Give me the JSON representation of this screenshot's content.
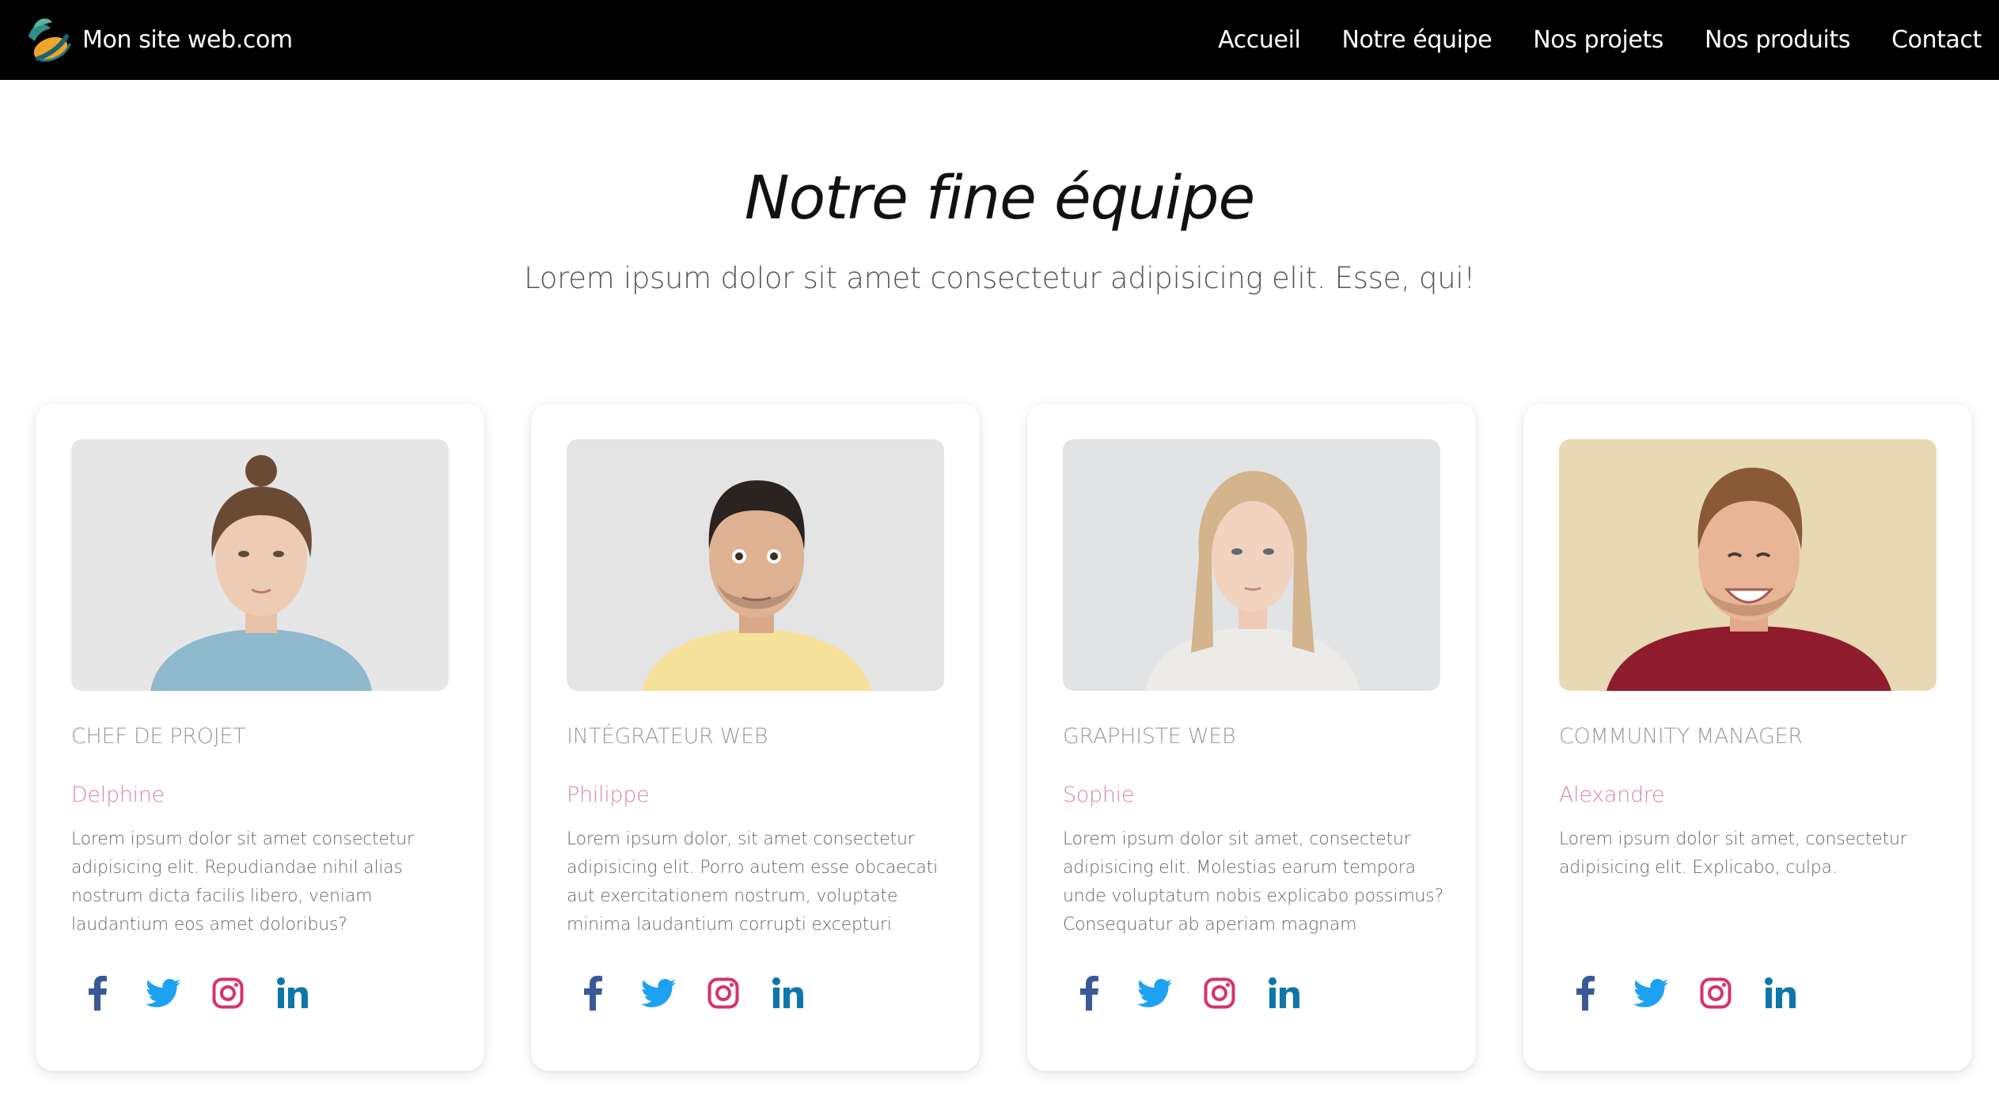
{
  "header": {
    "brand": "Mon site web.com",
    "nav": [
      "Accueil",
      "Notre équipe",
      "Nos projets",
      "Nos produits",
      "Contact"
    ]
  },
  "hero": {
    "title": "Notre fine équipe",
    "subtitle": "Lorem ipsum dolor sit amet consectetur adipisicing elit. Esse, qui!"
  },
  "cards": [
    {
      "role": "CHEF DE PROJET",
      "name": "Delphine",
      "text": "Lorem ipsum dolor sit amet consectetur adipisicing elit. Repudiandae nihil alias nostrum dicta facilis libero, veniam laudantium eos amet doloribus?",
      "photo_bg": "#e6e6e6"
    },
    {
      "role": "INTÉGRATEUR WEB",
      "name": "Philippe",
      "text": "Lorem ipsum dolor, sit amet consectetur adipisicing elit. Porro autem esse obcaecati aut exercitationem nostrum, voluptate minima laudantium corrupti excepturi saepe sed",
      "photo_bg": "#e4e4e4"
    },
    {
      "role": "GRAPHISTE WEB",
      "name": "Sophie",
      "text": "Lorem ipsum dolor sit amet, consectetur adipisicing elit. Molestias earum tempora unde voluptatum nobis explicabo possimus? Consequatur ab aperiam magnam reiciendis?",
      "photo_bg": "#e2e3e5"
    },
    {
      "role": "COMMUNITY MANAGER",
      "name": "Alexandre",
      "text": "Lorem ipsum dolor sit amet, consectetur adipisicing elit. Explicabo, culpa.",
      "photo_bg": "#e8d9b5"
    }
  ],
  "social": [
    {
      "icon": "facebook-icon",
      "color": "#3b5998"
    },
    {
      "icon": "twitter-icon",
      "color": "#1da1f2"
    },
    {
      "icon": "instagram-icon",
      "color": "#d6336c"
    },
    {
      "icon": "linkedin-icon",
      "color": "#0e76a8"
    }
  ]
}
